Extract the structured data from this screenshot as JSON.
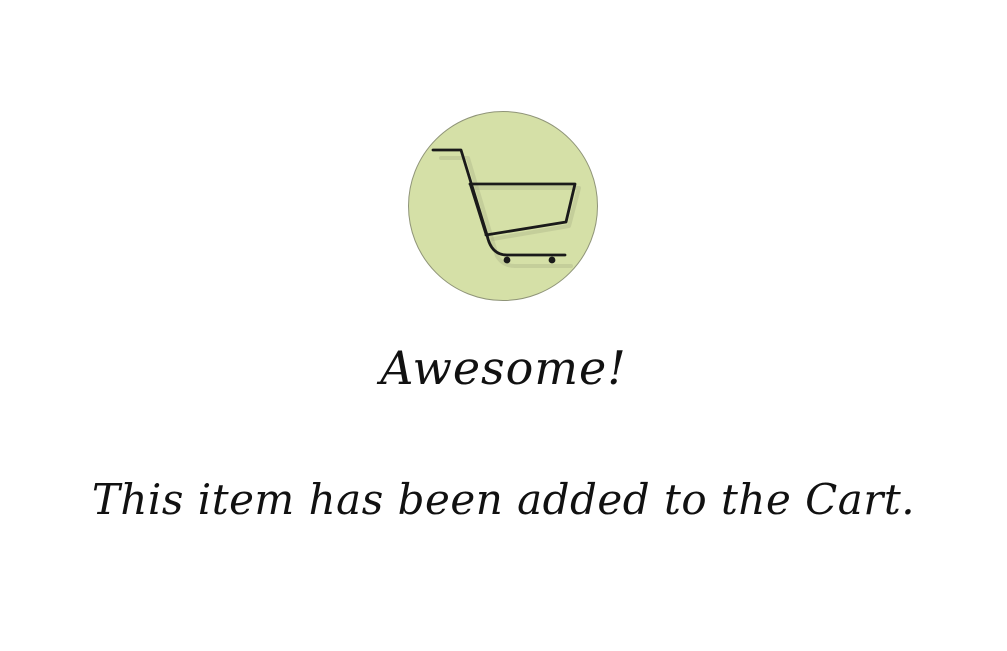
{
  "modal": {
    "icon": "shopping-cart-icon",
    "title": "Awesome!",
    "message": "This item has been added to the Cart."
  },
  "colors": {
    "background": "#ffffff",
    "circle_fill": "#d5e0a7",
    "circle_border": "#8f9478",
    "text": "#111111",
    "icon_stroke": "#1a1a1a"
  }
}
